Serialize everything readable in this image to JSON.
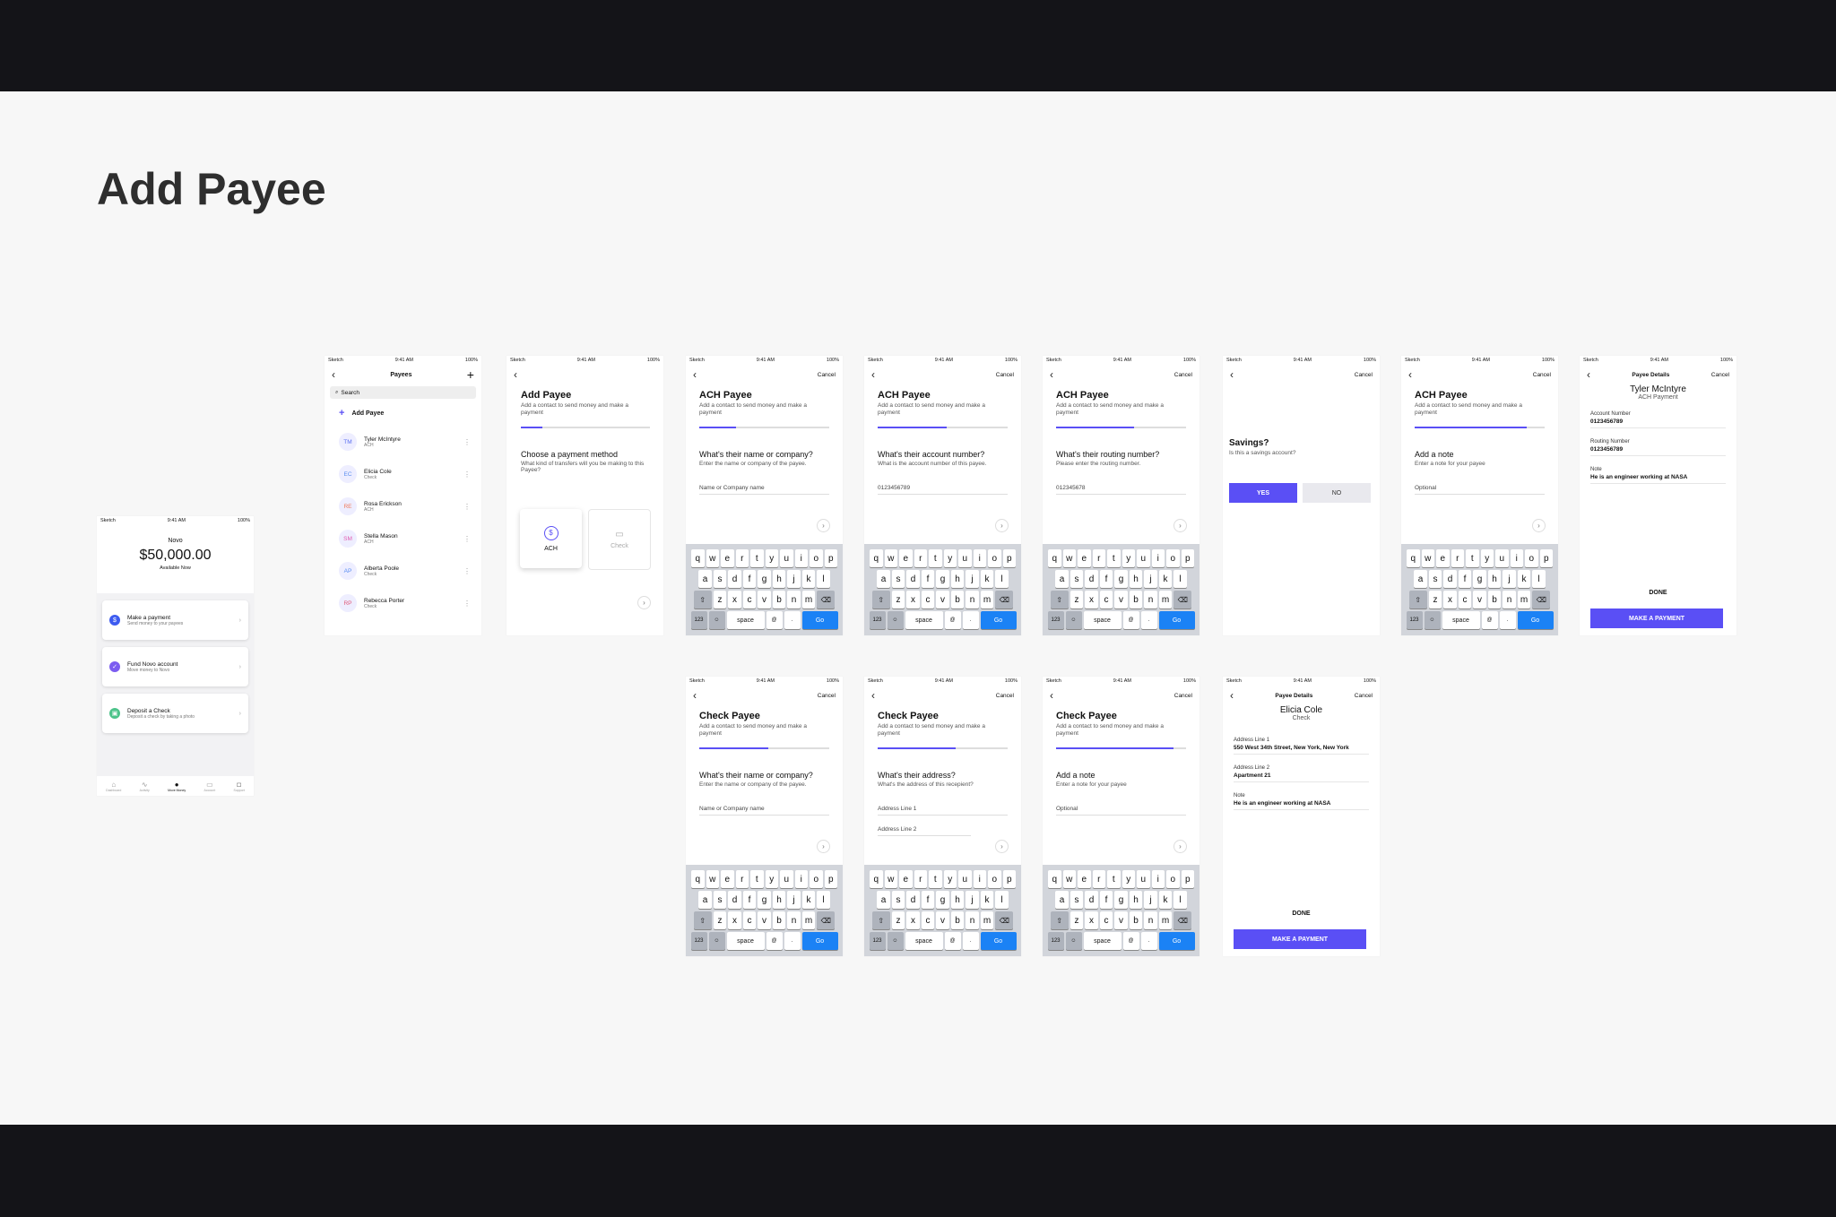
{
  "page_title": "Add Payee",
  "status": {
    "carrier": "Sketch",
    "time": "9:41 AM",
    "battery": "100%"
  },
  "common": {
    "cancel": "Cancel",
    "contact_subtitle": "Add a contact to send money and make a payment",
    "next_icon": "chevron-right",
    "keyboard": {
      "row1": [
        "q",
        "w",
        "e",
        "r",
        "t",
        "y",
        "u",
        "i",
        "o",
        "p"
      ],
      "row2": [
        "a",
        "s",
        "d",
        "f",
        "g",
        "h",
        "j",
        "k",
        "l"
      ],
      "row3": [
        "z",
        "x",
        "c",
        "v",
        "b",
        "n",
        "m"
      ],
      "num_label": "123",
      "space_label": "space",
      "at_label": "@",
      "dot_label": ".",
      "go_label": "Go"
    },
    "accent": "#5a4ff5"
  },
  "home": {
    "app_name": "Novo",
    "balance": "$50,000.00",
    "balance_caption": "Available Now",
    "actions": [
      {
        "title": "Make a payment",
        "subtitle": "Send money to your payees",
        "color": "#3d5bf0"
      },
      {
        "title": "Fund Novo account",
        "subtitle": "Move money to Novo",
        "color": "#7b5cf0"
      },
      {
        "title": "Deposit a Check",
        "subtitle": "Deposit a check by taking a photo",
        "color": "#4cc38a"
      }
    ],
    "tabs": [
      "Dashboard",
      "Activity",
      "Move Money",
      "Account",
      "Support"
    ]
  },
  "payees": {
    "title": "Payees",
    "search_placeholder": "Search",
    "add_label": "Add Payee",
    "list": [
      {
        "initials": "TM",
        "name": "Tyler McIntyre",
        "type": "ACH",
        "color": "#5a6ff0"
      },
      {
        "initials": "EC",
        "name": "Elicia Cole",
        "type": "Check",
        "color": "#5a8ef0"
      },
      {
        "initials": "RE",
        "name": "Rosa Erickson",
        "type": "ACH",
        "color": "#f07a5a"
      },
      {
        "initials": "SM",
        "name": "Stella Mason",
        "type": "ACH",
        "color": "#e05ab0"
      },
      {
        "initials": "AP",
        "name": "Alberta Poole",
        "type": "Check",
        "color": "#5a8ef0"
      },
      {
        "initials": "RP",
        "name": "Rebecca Porter",
        "type": "Check",
        "color": "#e05a7a"
      }
    ]
  },
  "method": {
    "title": "Add Payee",
    "question": "Choose a payment method",
    "question_sub": "What kind of transfers will you be making to this Payee?",
    "option_ach": "ACH",
    "option_check": "Check"
  },
  "ach": {
    "title": "ACH Payee",
    "steps": [
      {
        "q": "What's their name or company?",
        "sub": "Enter the name or company of the payee.",
        "field": "Name or Company name",
        "progress": 0.28
      },
      {
        "q": "What's their account number?",
        "sub": "What is the account number of this payee.",
        "field": "0123456789",
        "progress": 0.53
      },
      {
        "q": "What's their routing number?",
        "sub": "Please enter the routing number.",
        "field": "012345678",
        "progress": 0.6
      },
      {
        "q": "Add a note",
        "sub": "Enter a note for your payee",
        "field": "Optional",
        "progress": 0.86
      }
    ],
    "savings": {
      "q": "Savings?",
      "sub": "Is this a savings account?",
      "yes": "YES",
      "no": "NO"
    }
  },
  "ach_details": {
    "nav_title": "Payee Details",
    "name": "Tyler McIntyre",
    "type": "ACH Payment",
    "fields": [
      {
        "label": "Account Number",
        "value": "0123456789"
      },
      {
        "label": "Routing Number",
        "value": "0123456789"
      },
      {
        "label": "Note",
        "value": "He is an engineer working at NASA"
      }
    ],
    "done": "DONE",
    "cta": "MAKE A PAYMENT"
  },
  "check": {
    "title": "Check Payee",
    "steps": [
      {
        "q": "What's their name or company?",
        "sub": "Enter the name or company of the payee.",
        "field": "Name or Company name",
        "progress": 0.53
      },
      {
        "q": "What's their address?",
        "sub": "What's the address of this recepient?",
        "field": "Address Line 1",
        "field2": "Address Line 2",
        "progress": 0.6
      },
      {
        "q": "Add a note",
        "sub": "Enter a note for your payee",
        "field": "Optional",
        "progress": 0.9
      }
    ]
  },
  "check_details": {
    "nav_title": "Payee Details",
    "name": "Elicia Cole",
    "type": "Check",
    "fields": [
      {
        "label": "Address Line 1",
        "value": "550 West 34th Street, New York, New York"
      },
      {
        "label": "Address Line 2",
        "value": "Apartment 21"
      },
      {
        "label": "Note",
        "value": "He is an engineer working at NASA"
      }
    ],
    "done": "DONE",
    "cta": "MAKE A PAYMENT"
  }
}
